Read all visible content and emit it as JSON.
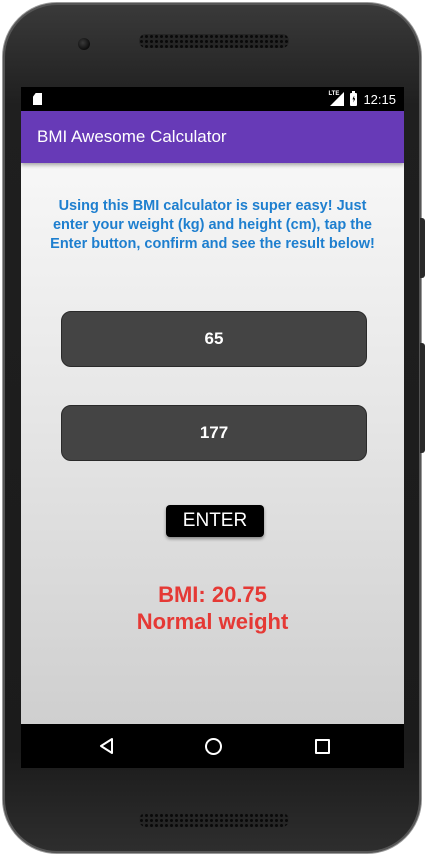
{
  "status_bar": {
    "network": "LTE",
    "time": "12:15",
    "icons": [
      "sd-card-icon",
      "cell-signal-icon",
      "battery-charging-icon"
    ]
  },
  "app_bar": {
    "title": "BMI Awesome Calculator",
    "color": "#673ab7"
  },
  "main": {
    "instructions": "Using this BMI calculator is super easy! Just enter your weight (kg) and height (cm), tap the Enter button, confirm and see the result below!",
    "weight_value": "65",
    "height_value": "177",
    "enter_label": "ENTER",
    "result_bmi": "BMI: 20.75",
    "result_category": "Normal weight",
    "instruction_color": "#1e7fcf",
    "result_color": "#e53935"
  },
  "nav_bar": {
    "icons": [
      "back-icon",
      "home-icon",
      "recents-icon"
    ]
  }
}
